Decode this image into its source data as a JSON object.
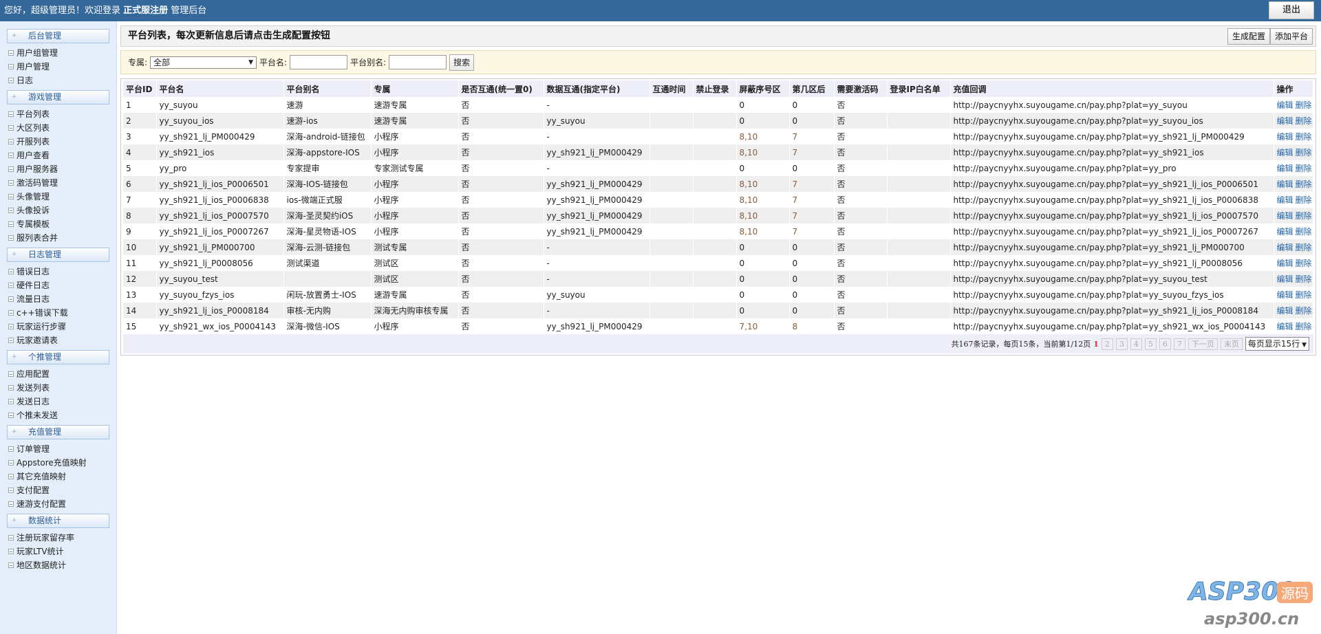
{
  "topbar": {
    "greeting": "您好，超级管理员！欢迎登录 ",
    "site": "正式服注册",
    "suffix": " 管理后台",
    "logout": "退出"
  },
  "sidebar": [
    {
      "header": "后台管理",
      "items": [
        "用户组管理",
        "用户管理",
        "日志"
      ]
    },
    {
      "header": "游戏管理",
      "items": [
        "平台列表",
        "大区列表",
        "开服列表",
        "用户查看",
        "用户服务器",
        "激活码管理",
        "头像管理",
        "头像投诉",
        "专属模板",
        "服列表合并"
      ]
    },
    {
      "header": "日志管理",
      "items": [
        "错误日志",
        "硬件日志",
        "流量日志",
        "c++错误下载",
        "玩家运行步骤",
        "玩家邀请表"
      ]
    },
    {
      "header": "个推管理",
      "items": [
        "应用配置",
        "发送列表",
        "发送日志",
        "个推未发送"
      ]
    },
    {
      "header": "充值管理",
      "items": [
        "订单管理",
        "Appstore充值映射",
        "其它充值映射",
        "支付配置",
        "速游支付配置"
      ]
    },
    {
      "header": "数据统计",
      "items": [
        "注册玩家留存率",
        "玩家LTV统计",
        "地区数据统计"
      ]
    }
  ],
  "main": {
    "title": "平台列表，每次更新信息后请点击生成配置按钮",
    "generate_btn": "生成配置",
    "add_btn": "添加平台",
    "search": {
      "exclusive_label": "专属:",
      "exclusive_value": "全部",
      "name_label": "平台名:",
      "name_value": "",
      "alias_label": "平台别名:",
      "alias_value": "",
      "search_btn": "搜索"
    },
    "columns": [
      "平台ID",
      "平台名",
      "平台别名",
      "专属",
      "是否互通(统一置0)",
      "数据互通(指定平台)",
      "互通时间",
      "禁止登录",
      "屏蔽序号区",
      "第几区后",
      "需要激活码",
      "登录IP白名单",
      "充值回调",
      "操作"
    ],
    "rows": [
      [
        "1",
        "yy_suyou",
        "速游",
        "速游专属",
        "否",
        "-",
        "",
        "",
        "0",
        "0",
        "否",
        "",
        "http://paycnyyhx.suyougame.cn/pay.php?plat=yy_suyou"
      ],
      [
        "2",
        "yy_suyou_ios",
        "速游-ios",
        "速游专属",
        "否",
        "yy_suyou",
        "",
        "",
        "0",
        "0",
        "否",
        "",
        "http://paycnyyhx.suyougame.cn/pay.php?plat=yy_suyou_ios"
      ],
      [
        "3",
        "yy_sh921_lj_PM000429",
        "深海-android-链接包",
        "小程序",
        "否",
        "-",
        "",
        "",
        "8,10",
        "7",
        "否",
        "",
        "http://paycnyyhx.suyougame.cn/pay.php?plat=yy_sh921_lj_PM000429"
      ],
      [
        "4",
        "yy_sh921_ios",
        "深海-appstore-IOS",
        "小程序",
        "否",
        "yy_sh921_lj_PM000429",
        "",
        "",
        "8,10",
        "7",
        "否",
        "",
        "http://paycnyyhx.suyougame.cn/pay.php?plat=yy_sh921_ios"
      ],
      [
        "5",
        "yy_pro",
        "专家提审",
        "专家测试专属",
        "否",
        "-",
        "",
        "",
        "0",
        "0",
        "否",
        "",
        "http://paycnyyhx.suyougame.cn/pay.php?plat=yy_pro"
      ],
      [
        "6",
        "yy_sh921_lj_ios_P0006501",
        "深海-IOS-链接包",
        "小程序",
        "否",
        "yy_sh921_lj_PM000429",
        "",
        "",
        "8,10",
        "7",
        "否",
        "",
        "http://paycnyyhx.suyougame.cn/pay.php?plat=yy_sh921_lj_ios_P0006501"
      ],
      [
        "7",
        "yy_sh921_lj_ios_P0006838",
        "ios-微端正式服",
        "小程序",
        "否",
        "yy_sh921_lj_PM000429",
        "",
        "",
        "8,10",
        "7",
        "否",
        "",
        "http://paycnyyhx.suyougame.cn/pay.php?plat=yy_sh921_lj_ios_P0006838"
      ],
      [
        "8",
        "yy_sh921_lj_ios_P0007570",
        "深海-圣灵契约iOS",
        "小程序",
        "否",
        "yy_sh921_lj_PM000429",
        "",
        "",
        "8,10",
        "7",
        "否",
        "",
        "http://paycnyyhx.suyougame.cn/pay.php?plat=yy_sh921_lj_ios_P0007570"
      ],
      [
        "9",
        "yy_sh921_lj_ios_P0007267",
        "深海-星灵物语-IOS",
        "小程序",
        "否",
        "yy_sh921_lj_PM000429",
        "",
        "",
        "8,10",
        "7",
        "否",
        "",
        "http://paycnyyhx.suyougame.cn/pay.php?plat=yy_sh921_lj_ios_P0007267"
      ],
      [
        "10",
        "yy_sh921_lj_PM000700",
        "深海-云测-链接包",
        "测试专属",
        "否",
        "-",
        "",
        "",
        "0",
        "0",
        "否",
        "",
        "http://paycnyyhx.suyougame.cn/pay.php?plat=yy_sh921_lj_PM000700"
      ],
      [
        "11",
        "yy_sh921_lj_P0008056",
        "测试渠道",
        "测试区",
        "否",
        "-",
        "",
        "",
        "0",
        "0",
        "否",
        "",
        "http://paycnyyhx.suyougame.cn/pay.php?plat=yy_sh921_lj_P0008056"
      ],
      [
        "12",
        "yy_suyou_test",
        "",
        "测试区",
        "否",
        "-",
        "",
        "",
        "0",
        "0",
        "否",
        "",
        "http://paycnyyhx.suyougame.cn/pay.php?plat=yy_suyou_test"
      ],
      [
        "13",
        "yy_suyou_fzys_ios",
        "闲玩-放置勇士-IOS",
        "速游专属",
        "否",
        "yy_suyou",
        "",
        "",
        "0",
        "0",
        "否",
        "",
        "http://paycnyyhx.suyougame.cn/pay.php?plat=yy_suyou_fzys_ios"
      ],
      [
        "14",
        "yy_sh921_lj_ios_P0008184",
        "审核-无内购",
        "深海无内购审核专属",
        "否",
        "-",
        "",
        "",
        "0",
        "0",
        "否",
        "",
        "http://paycnyyhx.suyougame.cn/pay.php?plat=yy_sh921_lj_ios_P0008184"
      ],
      [
        "15",
        "yy_sh921_wx_ios_P0004143",
        "深海-微信-IOS",
        "小程序",
        "否",
        "yy_sh921_lj_PM000429",
        "",
        "",
        "7,10",
        "8",
        "否",
        "",
        "http://paycnyyhx.suyougame.cn/pay.php?plat=yy_sh921_wx_ios_P0004143"
      ]
    ],
    "edit_label": "编辑",
    "delete_label": "删除",
    "pager": {
      "summary": "共167条记录，每页15条，当前第1/12页",
      "current": "1",
      "pages": [
        "2",
        "3",
        "4",
        "5",
        "6",
        "7"
      ],
      "next": "下一页",
      "last": "末页",
      "per_page": "每页显示15行"
    }
  },
  "watermark": {
    "brand": "ASP300",
    "tag": "源码",
    "url": "asp300.cn"
  },
  "colors": {
    "topbar": "#35689a",
    "link": "#2266aa",
    "highlight": "#8a5a3c"
  }
}
